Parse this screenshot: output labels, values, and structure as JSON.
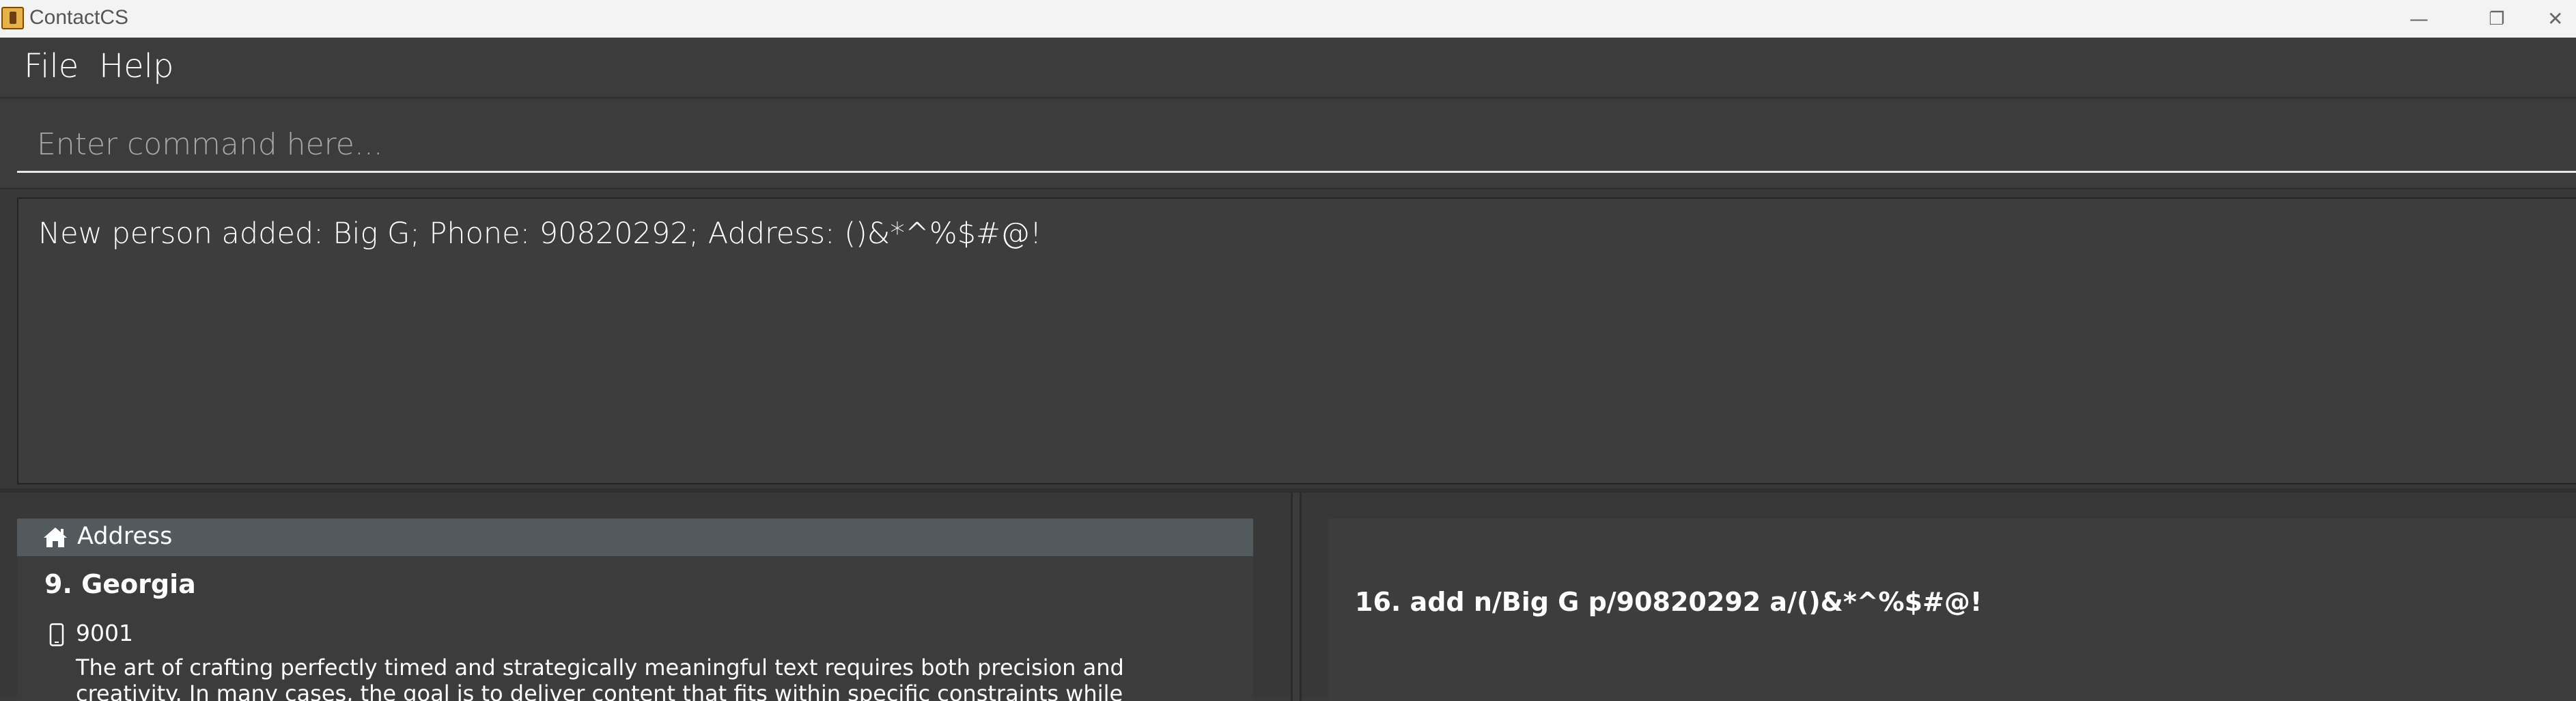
{
  "window": {
    "title": "ContactCS",
    "controls": {
      "minimize": "—",
      "maximize": "❐",
      "close": "✕"
    }
  },
  "menu": {
    "items": [
      "File",
      "Help"
    ]
  },
  "command": {
    "placeholder": "Enter command here...",
    "value": ""
  },
  "result": {
    "message": "New person added: Big G; Phone: 90820292; Address: ()&*^%$#@!"
  },
  "person_list": {
    "header_label": "Address",
    "header_icon": "home-icon",
    "person": {
      "name": "9. Georgia",
      "phone_icon": "phone-icon",
      "phone": "9001",
      "description": "The art of crafting perfectly timed and strategically meaningful text requires both precision and creativity. In many cases, the goal is to deliver content that fits within specific constraints while maintaining coherence, clarity, and"
    }
  },
  "command_history": {
    "items": [
      "16. add n/Big G p/90820292 a/()&*^%$#@!"
    ]
  },
  "colors": {
    "background": "#3c3c3c",
    "titlebar": "#f3f3f3",
    "address_header": "#525a5e",
    "text": "#ffffff"
  }
}
